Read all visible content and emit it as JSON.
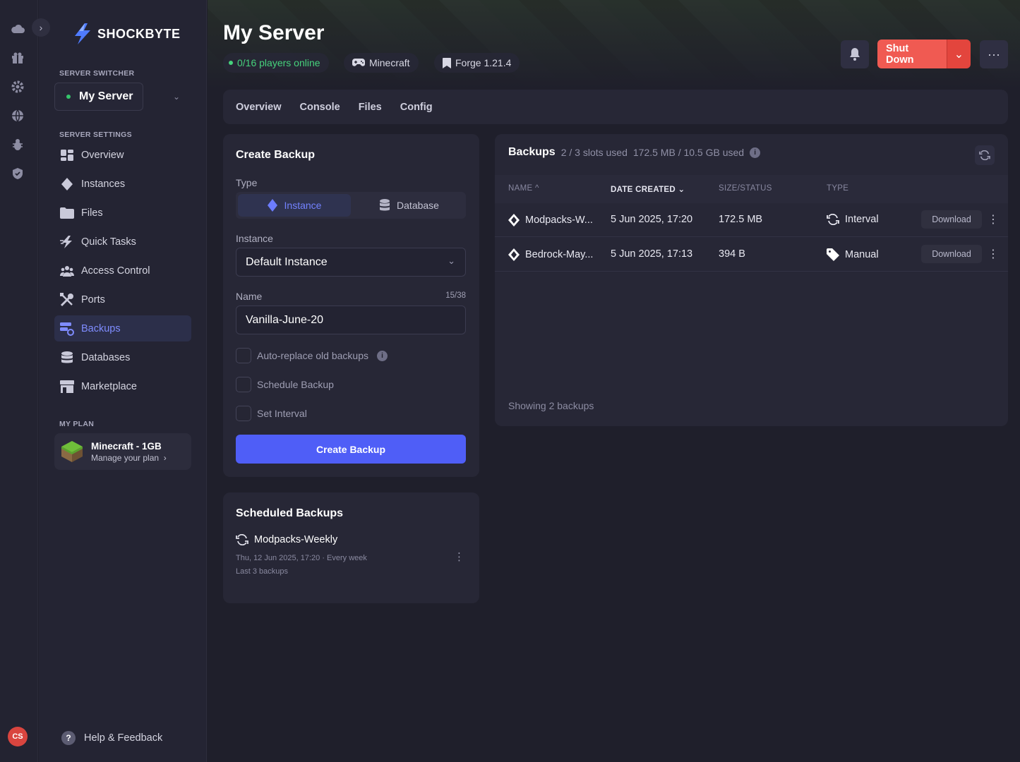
{
  "app": {
    "brand": "SHOCKBYTE"
  },
  "rail": {
    "icons": [
      "cloud-icon",
      "gift-icon",
      "gear-icon",
      "globe-icon",
      "bug-icon",
      "shield-icon"
    ],
    "avatar": "CS"
  },
  "sidebar": {
    "server_switcher_label": "SERVER SWITCHER",
    "server_name": "My Server",
    "settings_label": "SERVER SETTINGS",
    "items": [
      {
        "label": "Overview",
        "icon": "dashboard-icon"
      },
      {
        "label": "Instances",
        "icon": "diamond-icon"
      },
      {
        "label": "Files",
        "icon": "folder-icon"
      },
      {
        "label": "Quick Tasks",
        "icon": "lightning-icon"
      },
      {
        "label": "Access Control",
        "icon": "users-icon"
      },
      {
        "label": "Ports",
        "icon": "tools-icon"
      },
      {
        "label": "Backups",
        "icon": "backup-icon",
        "active": true
      },
      {
        "label": "Databases",
        "icon": "database-icon"
      },
      {
        "label": "Marketplace",
        "icon": "store-icon"
      }
    ],
    "plan_label": "MY PLAN",
    "plan_title": "Minecraft - 1GB",
    "plan_sub": "Manage your plan",
    "help": "Help & Feedback"
  },
  "header": {
    "title": "My Server",
    "players": "0/16 players online",
    "game": "Minecraft",
    "version": "Forge 1.21.4",
    "shutdown": "Shut Down"
  },
  "tabs": [
    "Overview",
    "Console",
    "Files",
    "Config"
  ],
  "create_backup": {
    "title": "Create Backup",
    "type_label": "Type",
    "type_instance": "Instance",
    "type_database": "Database",
    "instance_label": "Instance",
    "instance_value": "Default Instance",
    "name_label": "Name",
    "name_count": "15/38",
    "name_value": "Vanilla-June-20",
    "auto_replace": "Auto-replace old backups",
    "schedule": "Schedule Backup",
    "interval": "Set Interval",
    "button": "Create Backup"
  },
  "scheduled": {
    "title": "Scheduled Backups",
    "item_name": "Modpacks-Weekly",
    "item_when": "Thu, 12 Jun 2025, 17:20 · Every week",
    "item_keep": "Last 3 backups"
  },
  "backups": {
    "title": "Backups",
    "slots": "2 / 3 slots used",
    "storage": "172.5 MB / 10.5 GB used",
    "columns": {
      "name": "NAME",
      "date": "DATE CREATED",
      "size": "SIZE/STATUS",
      "type": "TYPE"
    },
    "rows": [
      {
        "name": "Modpacks-W...",
        "date": "5 Jun 2025, 17:20",
        "size": "172.5 MB",
        "type": "Interval",
        "action": "Download"
      },
      {
        "name": "Bedrock-May...",
        "date": "5 Jun 2025, 17:13",
        "size": "394 B",
        "type": "Manual",
        "action": "Download"
      }
    ],
    "showing": "Showing 2 backups"
  },
  "colors": {
    "accent": "#4f5ef7",
    "danger": "#f05a52",
    "online": "#46d27c"
  }
}
